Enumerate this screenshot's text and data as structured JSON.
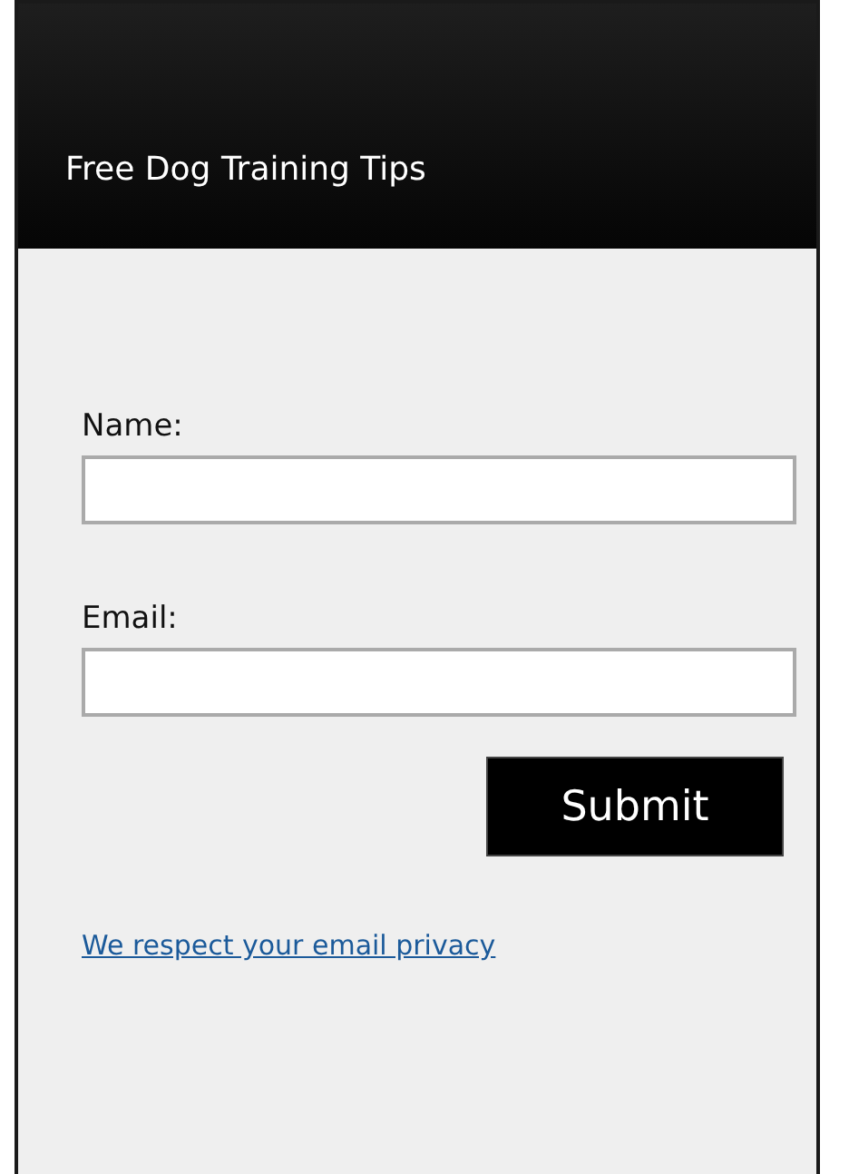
{
  "header": {
    "title": "Free Dog Training Tips"
  },
  "fields": [
    {
      "label": "Name:"
    },
    {
      "label": "Email:"
    }
  ],
  "submit": {
    "label": "Submit"
  },
  "privacy_link": {
    "label": "We respect your email privacy"
  }
}
